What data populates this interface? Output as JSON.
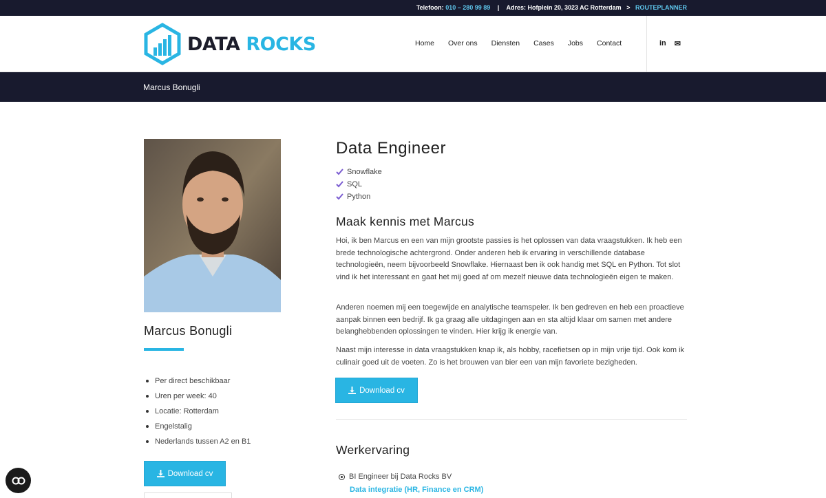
{
  "topbar": {
    "phone_label": "Telefoon:",
    "phone": "010 – 280 99 89",
    "separator": "|",
    "address": "Adres: Hofplein 20, 3023 AC Rotterdam",
    "arrow": ">",
    "route_link": "ROUTEPLANNER"
  },
  "logo": {
    "part1": "DATA",
    "part2": "ROCKS"
  },
  "nav": [
    "Home",
    "Over ons",
    "Diensten",
    "Cases",
    "Jobs",
    "Contact"
  ],
  "social": {
    "linkedin": "in",
    "mail": "✉"
  },
  "titlebar": {
    "title": "Marcus Bonugli"
  },
  "profile": {
    "name": "Marcus Bonugli",
    "facts": [
      "Per direct beschikbaar",
      "Uren per week: 40",
      "Locatie: Rotterdam",
      "Engelstalig",
      "Nederlands tussen A2 en B1"
    ],
    "download_label": "Download cv"
  },
  "main": {
    "role": "Data Engineer",
    "skills": [
      "Snowflake",
      "SQL",
      "Python"
    ],
    "intro_heading": "Maak kennis met Marcus",
    "paragraphs": [
      "Hoi, ik ben Marcus en een van mijn grootste passies is het oplossen van data vraagstukken. Ik heb een brede technologische achtergrond. Onder anderen heb ik ervaring in verschillende database technologieën, neem bijvoorbeeld Snowflake. Hiernaast ben ik ook handig met SQL en Python. Tot slot vind ik het interessant en gaat het mij goed af om mezelf nieuwe data technologieën eigen te maken.",
      "Anderen noemen mij een toegewijde en analytische teamspeler. Ik ben gedreven en heb een proactieve aanpak binnen een bedrijf. Ik ga graag alle uitdagingen aan en sta altijd klaar om samen met andere belanghebbenden oplossingen te vinden. Hier krijg ik energie van.",
      "Naast mijn interesse in data vraagstukken knap ik, als hobby, racefietsen op in mijn vrije tijd. Ook kom ik culinair goed uit de voeten. Zo is het brouwen van bier een van mijn favoriete bezigheden."
    ],
    "download_label": "Download cv",
    "work_heading": "Werkervaring",
    "job_title": "BI Engineer bij Data Rocks BV",
    "job_detail": "Data integratie (HR, Finance en CRM)"
  },
  "colors": {
    "accent": "#29b5e3",
    "dark": "#181a2e"
  },
  "icons": {
    "skill": "check-icon",
    "download": "download-icon",
    "cookie": "cookie-settings-icon"
  }
}
